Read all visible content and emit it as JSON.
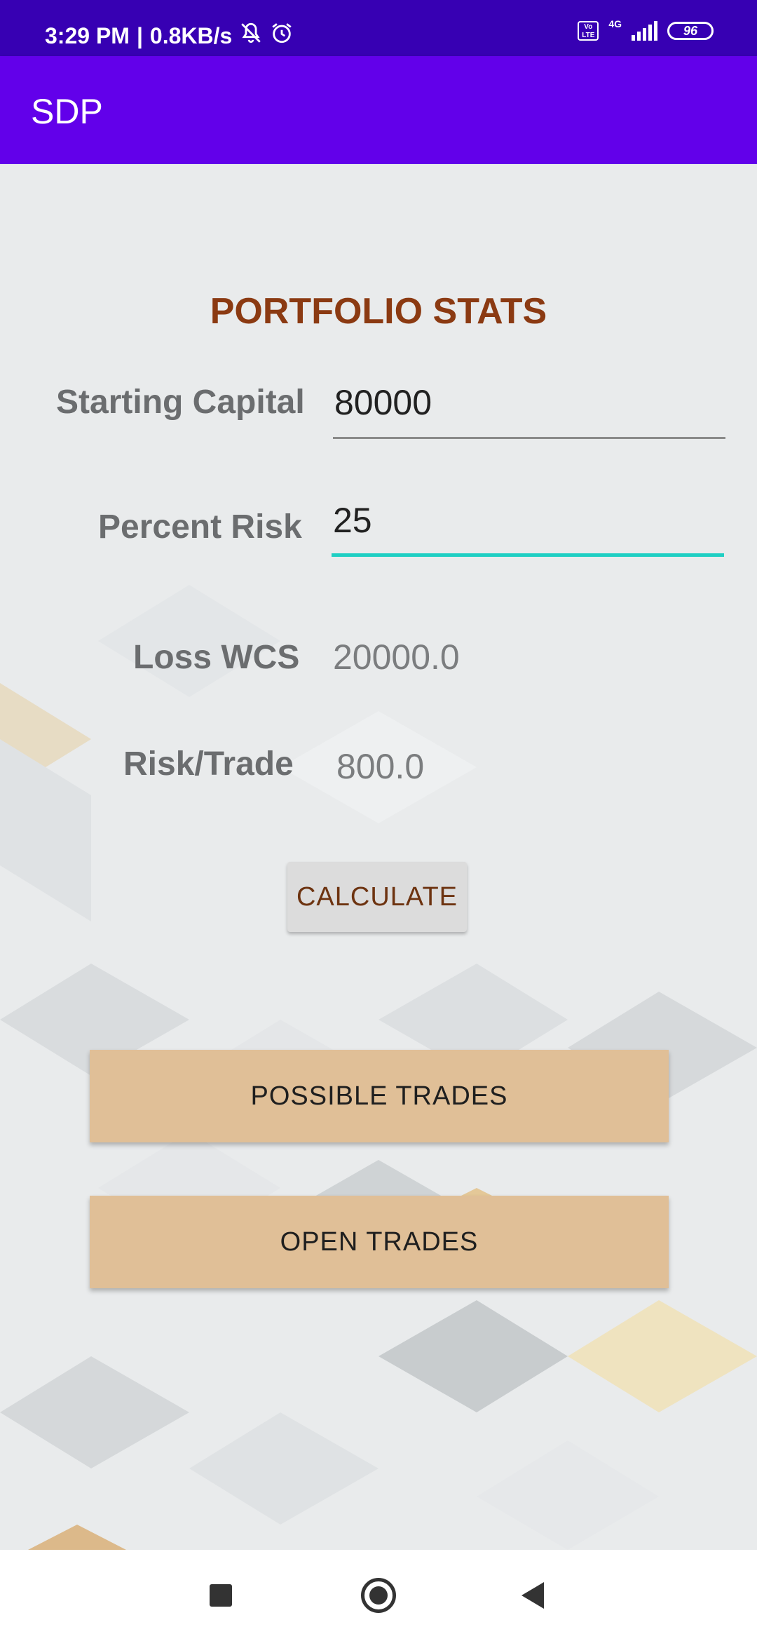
{
  "status_bar": {
    "time": "3:29 PM",
    "separator": "|",
    "speed": "0.8KB/s",
    "volte": "Vo LTE",
    "network": "4G",
    "battery": "96"
  },
  "app_bar": {
    "title": "SDP"
  },
  "portfolio": {
    "title": "PORTFOLIO STATS",
    "starting_capital_label": "Starting Capital",
    "starting_capital_value": "80000",
    "percent_risk_label": "Percent Risk",
    "percent_risk_value": "25",
    "loss_wcs_label": "Loss WCS",
    "loss_wcs_value": "20000.0",
    "risk_trade_label": "Risk/Trade",
    "risk_trade_value": "800.0"
  },
  "buttons": {
    "calculate": "CALCULATE",
    "possible_trades": "POSSIBLE TRADES",
    "open_trades": "OPEN TRADES"
  },
  "colors": {
    "status_bar": "#3700b3",
    "app_bar": "#6200ea",
    "title_accent": "#8b3a12",
    "focus_underline": "#1fcfc3",
    "action_button": "#e0bf97"
  },
  "icons": {
    "status": [
      "mute-icon",
      "alarm-icon",
      "signal-icon",
      "battery-icon"
    ],
    "nav": [
      "recents-icon",
      "home-icon",
      "back-icon"
    ]
  }
}
